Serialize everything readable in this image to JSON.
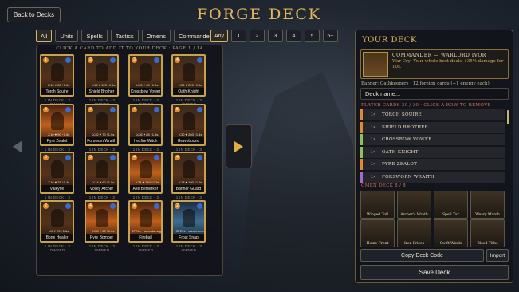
{
  "header": {
    "back_label": "Back to Decks",
    "title": "FORGE DECK"
  },
  "filters": [
    "All",
    "Units",
    "Spells",
    "Tactics",
    "Omens",
    "Commander"
  ],
  "costs": [
    "Any",
    "1",
    "2",
    "3",
    "4",
    "5",
    "6+"
  ],
  "collection": {
    "hint": "CLICK A CARD TO ADD IT TO YOUR DECK · PAGE 1 / 14",
    "cards": [
      {
        "name": "Torch Squire",
        "cost": "1",
        "stats": "⚔10 ♥ 80 ↑1.6s",
        "owned": "1 IN DECK · 3 OWNED",
        "style": "normal"
      },
      {
        "name": "Shield Brother",
        "cost": "3",
        "stats": "⚔15 ♥ 125 ↑1.6s",
        "owned": "1 IN DECK · 3 OWNED",
        "style": "normal"
      },
      {
        "name": "Crossbow Vower",
        "cost": "3",
        "stats": "⚔26 ♥ 60 ↑1.6s",
        "owned": "1 IN DECK · 3 OWNED",
        "style": "normal"
      },
      {
        "name": "Oath Knight",
        "cost": "4",
        "stats": "⚔32 ♥ 220 ↑1.5s",
        "owned": "1 IN DECK · 3 OWNED",
        "style": "normal"
      },
      {
        "name": "Pyre Zealot",
        "cost": "3",
        "stats": "⚔10 ♥ 90 ↑1.6s",
        "owned": "1 IN DECK · 3 OWNED",
        "style": "fire"
      },
      {
        "name": "Forsworn Wraith",
        "cost": "3",
        "stats": "⚔22 ♥ 70 ↑1.5s",
        "owned": "1 IN DECK · 3 OWNED",
        "style": "normal"
      },
      {
        "name": "Hexfire Witch",
        "cost": "4",
        "stats": "⚔28 ♥ 85 ↑1.5s",
        "owned": "1 IN DECK · 3 OWNED",
        "style": "normal"
      },
      {
        "name": "Gravebound",
        "cost": "5",
        "stats": "⚔30 ♥ 260 ↑1.4s",
        "owned": "1 IN DECK · 3 OWNED",
        "style": "normal"
      },
      {
        "name": "Valkyrie",
        "cost": "3",
        "stats": "⚔16 ♥ 75 ↑1.4s",
        "owned": "1 IN DECK · 3 OWNED",
        "style": "normal"
      },
      {
        "name": "Volley Archer",
        "cost": "3",
        "stats": "⚔14 ♥ 60 ↑1.5s",
        "owned": "1 IN DECK · 3 OWNED",
        "style": "normal"
      },
      {
        "name": "Axe Berserker",
        "cost": "4",
        "stats": "⚔34 ♥ 140 ↑1.3s",
        "owned": "1 IN DECK · 3 OWNED",
        "style": "fire"
      },
      {
        "name": "Banner Guard",
        "cost": "4",
        "stats": "⚔18 ♥ 190 ↑1.6s",
        "owned": "1 IN DECK · 3 OWNED",
        "style": "normal"
      },
      {
        "name": "Bone Healer",
        "cost": "2",
        "stats": "⚔8 ♥ 70 ↑1.6s",
        "owned": "1 IN DECK · 3 OWNED",
        "style": "normal"
      },
      {
        "name": "Pyre Bomber",
        "cost": "4",
        "stats": "⚔28 ♥ 60 ↑1.6s",
        "owned": "1 IN DECK · 3 OWNED",
        "style": "fire"
      },
      {
        "name": "Fireball",
        "cost": "4",
        "stats": "SPELL · area damage",
        "owned": "1 IN DECK · 3 OWNED",
        "style": "fire"
      },
      {
        "name": "Frost Snap",
        "cost": "2",
        "stats": "SPELL · area freeze",
        "owned": "1 IN DECK · 3 OWNED",
        "style": "blue"
      }
    ]
  },
  "deck": {
    "title": "YOUR DECK",
    "commander_name": "COMMANDER — WARLORD IVOR",
    "commander_desc": "War Cry: Your whole host deals +35% damage for 10s.",
    "banner": "Banner: Oathkeepers · 12 foreign cards (+1 energy each)",
    "name_placeholder": "Deck name...",
    "player_cards_header": "PLAYER CARDS  30 / 30 · CLICK A ROW TO REMOVE",
    "player_cards": [
      {
        "qty": "1×",
        "name": "TORCH SQUIRE",
        "color": "#e28a30"
      },
      {
        "qty": "1×",
        "name": "SHIELD BROTHER",
        "color": "#e28a30"
      },
      {
        "qty": "1×",
        "name": "CROSSBOW VOWER",
        "color": "#8fc05a"
      },
      {
        "qty": "1×",
        "name": "OATH KNIGHT",
        "color": "#8fc05a"
      },
      {
        "qty": "1×",
        "name": "PYRE ZEALOT",
        "color": "#e28a30"
      },
      {
        "qty": "1×",
        "name": "FORSWORN WRAITH",
        "color": "#a06ad0"
      }
    ],
    "omen_header": "OMEN DECK  8 / 8",
    "omens": [
      {
        "name": "Winged Toll"
      },
      {
        "name": "Archer's Wrath"
      },
      {
        "name": "Spell Tax"
      },
      {
        "name": "Weary March"
      },
      {
        "name": "Home Front"
      },
      {
        "name": "Iron Prices"
      },
      {
        "name": "Swift Winds"
      },
      {
        "name": "Blood Tithe"
      }
    ],
    "copy_label": "Copy Deck Code",
    "import_label": "Import",
    "save_label": "Save Deck"
  }
}
